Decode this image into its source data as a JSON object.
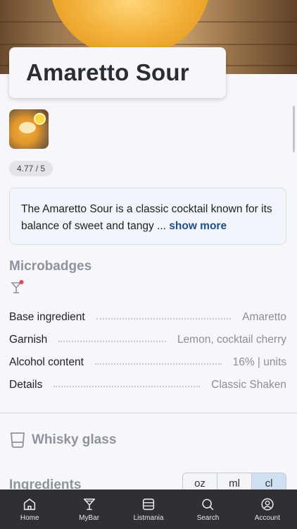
{
  "recipe": {
    "title": "Amaretto Sour",
    "rating": "4.77 / 5",
    "description": "The Amaretto Sour is a classic cocktail known for its balance of sweet and tangy ...",
    "show_more": "show more"
  },
  "microbadges": {
    "title": "Microbadges",
    "icons": [
      "cocktail-glass-badge-icon"
    ]
  },
  "details": [
    {
      "label": "Base ingredient",
      "value": "Amaretto"
    },
    {
      "label": "Garnish",
      "value": "Lemon, cocktail cherry"
    },
    {
      "label": "Alcohol content",
      "value": "16% | units"
    },
    {
      "label": "Details",
      "value": "Classic  Shaken"
    }
  ],
  "glass": {
    "label": "Whisky glass",
    "icon": "whisky-glass-icon"
  },
  "ingredients": {
    "title": "Ingredients",
    "units": [
      "oz",
      "ml",
      "cl"
    ],
    "selected_unit": "cl"
  },
  "tabs": [
    {
      "label": "Home",
      "icon": "home-icon"
    },
    {
      "label": "MyBar",
      "icon": "cocktail-icon"
    },
    {
      "label": "Listmania",
      "icon": "list-icon"
    },
    {
      "label": "Search",
      "icon": "search-icon"
    },
    {
      "label": "Account",
      "icon": "account-icon"
    }
  ],
  "colors": {
    "accent": "#1f4f8c",
    "tabbar": "#2e3035",
    "selected_unit_bg": "#cfe0f3"
  }
}
